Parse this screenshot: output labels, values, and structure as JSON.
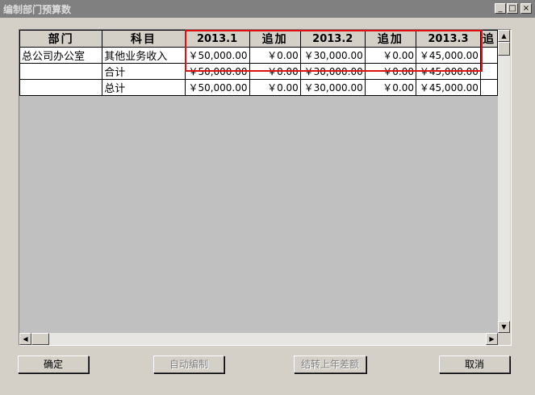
{
  "window": {
    "title": "编制部门预算数",
    "minimize_glyph": "_",
    "maximize_glyph": "□",
    "close_glyph": "×"
  },
  "grid": {
    "columns": [
      "部门",
      "科目",
      "2013.1",
      "追加",
      "2013.2",
      "追加",
      "2013.3",
      "追"
    ],
    "rows": [
      [
        "总公司办公室",
        "其他业务收入",
        "￥50,000.00",
        "￥0.00",
        "￥30,000.00",
        "￥0.00",
        "￥45,000.00",
        ""
      ],
      [
        "",
        "合计",
        "￥50,000.00",
        "￥0.00",
        "￥30,000.00",
        "￥0.00",
        "￥45,000.00",
        ""
      ],
      [
        "",
        "总计",
        "￥50,000.00",
        "￥0.00",
        "￥30,000.00",
        "￥0.00",
        "￥45,000.00",
        ""
      ]
    ],
    "highlight_color": "#e01010"
  },
  "scrollbars": {
    "up_glyph": "▲",
    "down_glyph": "▼",
    "left_glyph": "◀",
    "right_glyph": "▶"
  },
  "buttons": {
    "confirm": "确定",
    "auto_compile": "自动编制",
    "carry_over": "结转上年差额",
    "cancel": "取消"
  }
}
